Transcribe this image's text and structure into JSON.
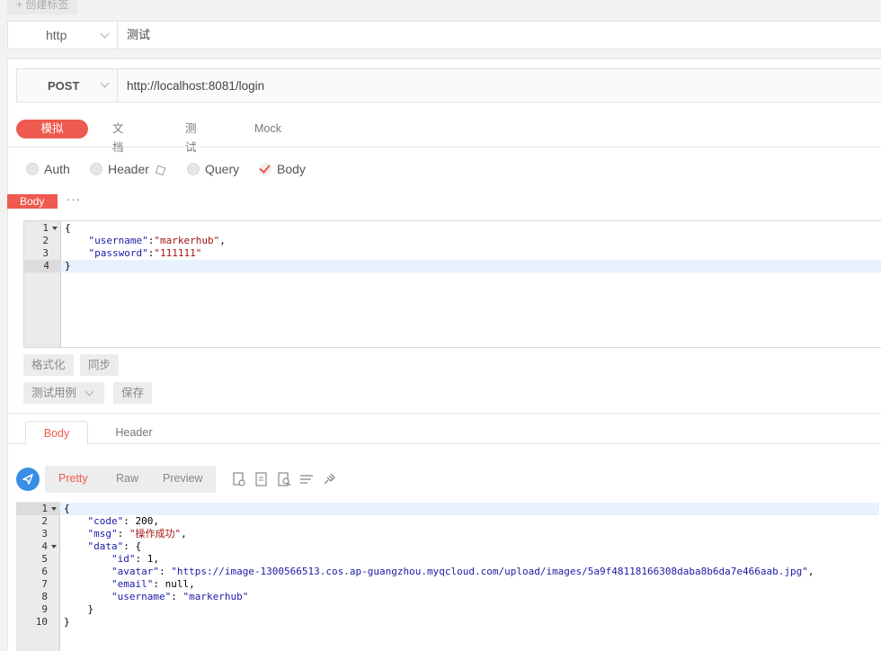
{
  "create_tag_label": "+ 创建标签",
  "protocol": {
    "value": "http",
    "name": "测试"
  },
  "request": {
    "method": "POST",
    "url": "http://localhost:8081/login"
  },
  "tabs": [
    "模拟",
    "文档",
    "测试",
    "Mock"
  ],
  "params": {
    "auth": "Auth",
    "header": "Header",
    "query": "Query",
    "body": "Body"
  },
  "body_badge": "Body",
  "more_label": "···",
  "request_body_lines": [
    "{",
    "    \"username\":\"markerhub\",",
    "    \"password\":\"111111\"",
    "}"
  ],
  "editor_buttons": {
    "format": "格式化",
    "sync": "同步",
    "testcase": "测试用例",
    "save": "保存"
  },
  "response_tabs": {
    "body": "Body",
    "header": "Header"
  },
  "view_modes": {
    "pretty": "Pretty",
    "raw": "Raw",
    "preview": "Preview"
  },
  "response_lines": [
    "{",
    "    \"code\": 200,",
    "    \"msg\": \"操作成功\",",
    "    \"data\": {",
    "        \"id\": 1,",
    "        \"avatar\": \"https://image-1300566513.cos.ap-guangzhou.myqcloud.com/upload/images/5a9f48118166308daba8b6da7e466aab.jpg\",",
    "        \"email\": null,",
    "        \"username\": \"markerhub\"",
    "    }",
    "}"
  ],
  "colors": {
    "accent": "#ee5a4f",
    "send": "#3a8ee6"
  }
}
